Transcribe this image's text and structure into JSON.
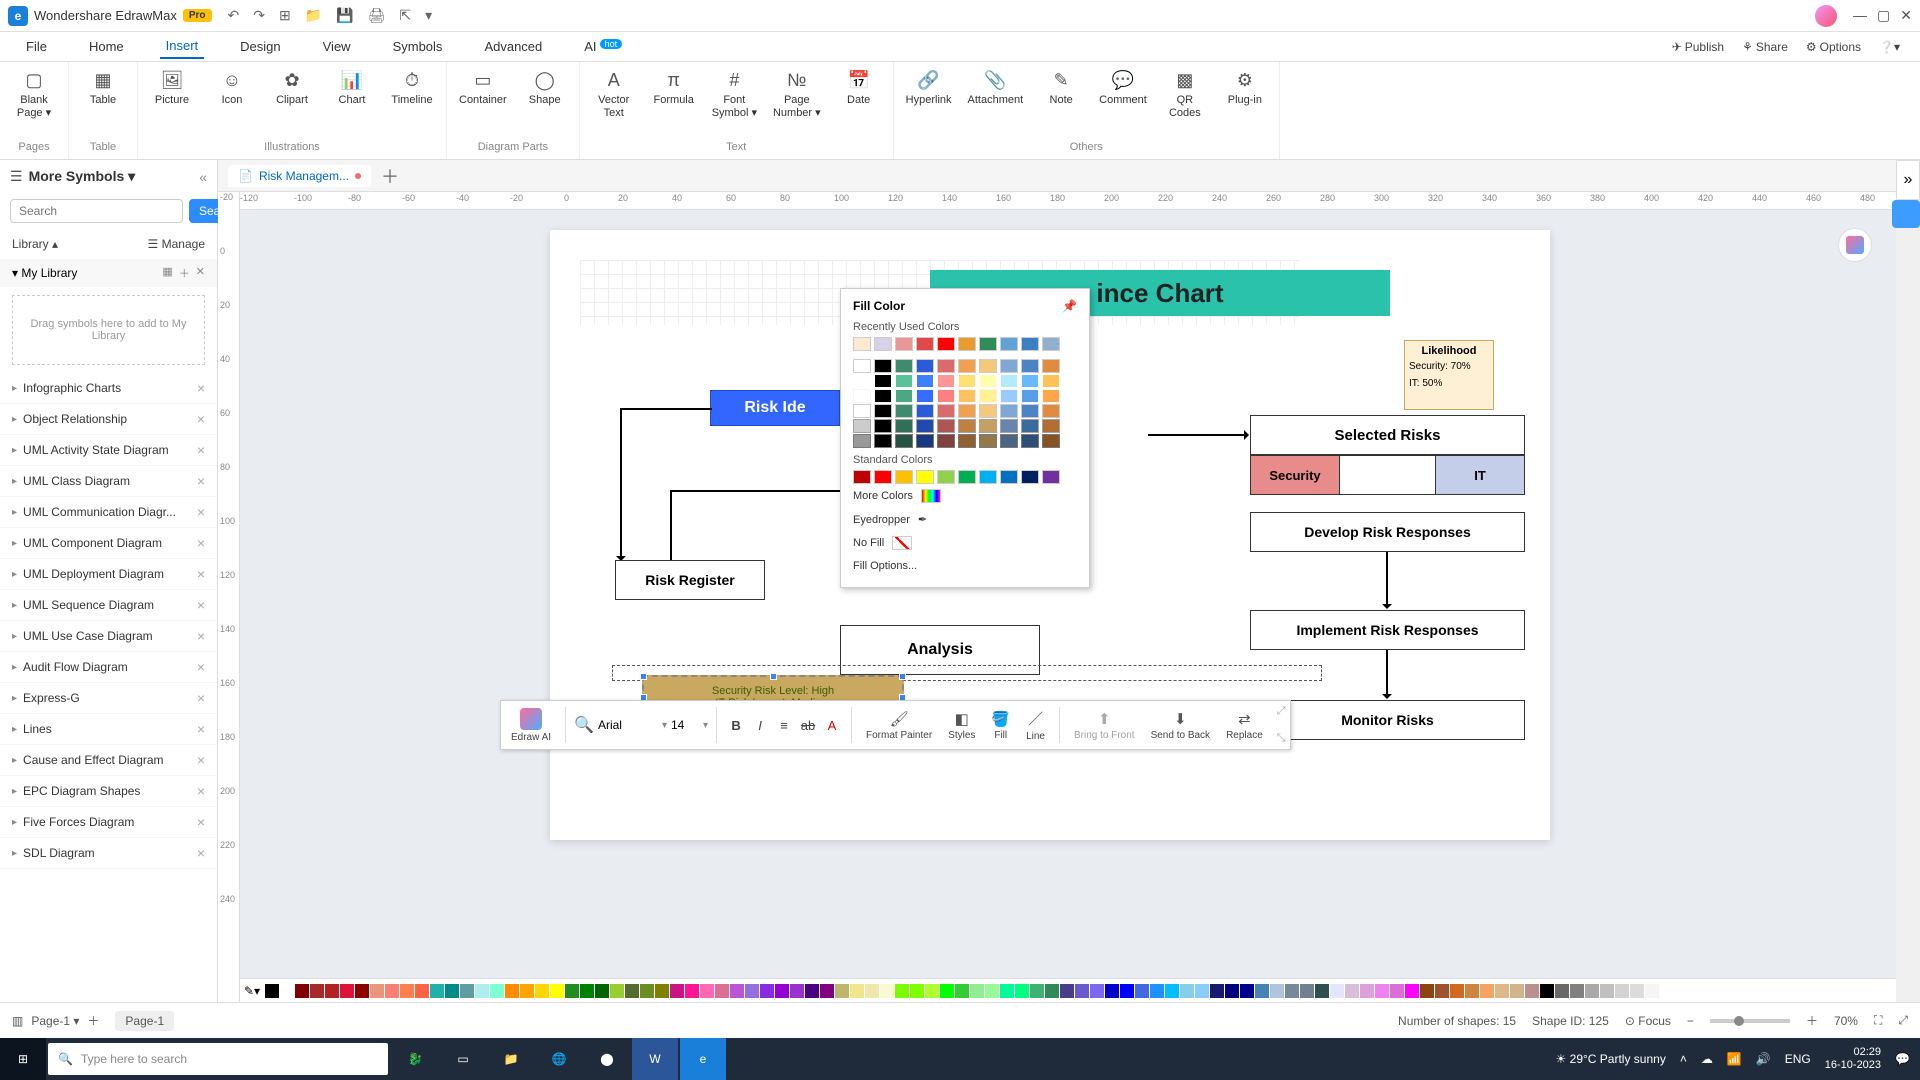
{
  "app": {
    "name": "Wondershare EdrawMax",
    "badge": "Pro"
  },
  "menubar": {
    "items": [
      "File",
      "Home",
      "Insert",
      "Design",
      "View",
      "Symbols",
      "Advanced",
      "AI"
    ],
    "active_index": 2,
    "right": {
      "publish": "Publish",
      "share": "Share",
      "options": "Options"
    }
  },
  "ribbon": {
    "groups": [
      {
        "label": "Pages",
        "items": [
          {
            "label": "Blank\nPage ▾"
          }
        ]
      },
      {
        "label": "Table",
        "items": [
          {
            "label": "Table"
          }
        ]
      },
      {
        "label": "Illustrations",
        "items": [
          {
            "label": "Picture"
          },
          {
            "label": "Icon"
          },
          {
            "label": "Clipart"
          },
          {
            "label": "Chart"
          },
          {
            "label": "Timeline"
          }
        ]
      },
      {
        "label": "Diagram Parts",
        "items": [
          {
            "label": "Container"
          },
          {
            "label": "Shape"
          }
        ]
      },
      {
        "label": "Text",
        "items": [
          {
            "label": "Vector\nText"
          },
          {
            "label": "Formula"
          },
          {
            "label": "Font\nSymbol ▾"
          },
          {
            "label": "Page\nNumber ▾"
          },
          {
            "label": "Date"
          }
        ]
      },
      {
        "label": "Others",
        "items": [
          {
            "label": "Hyperlink"
          },
          {
            "label": "Attachment"
          },
          {
            "label": "Note"
          },
          {
            "label": "Comment"
          },
          {
            "label": "QR\nCodes"
          },
          {
            "label": "Plug-in"
          }
        ]
      }
    ]
  },
  "sidebar": {
    "title": "More Symbols",
    "search_placeholder": "Search",
    "search_button": "Search",
    "library": "Library",
    "manage": "Manage",
    "mylib": "My Library",
    "dropzone": "Drag symbols here to add to My Library",
    "categories": [
      "Infographic Charts",
      "Object Relationship",
      "UML Activity State Diagram",
      "UML Class Diagram",
      "UML Communication Diagr...",
      "UML Component Diagram",
      "UML Deployment Diagram",
      "UML Sequence Diagram",
      "UML Use Case Diagram",
      "Audit Flow Diagram",
      "Express-G",
      "Lines",
      "Cause and Effect Diagram",
      "EPC Diagram Shapes",
      "Five Forces Diagram",
      "SDL Diagram"
    ]
  },
  "doc_tab": {
    "name": "Risk Managem...",
    "modified": true
  },
  "ruler_h": [
    "-120",
    "-100",
    "-80",
    "-60",
    "-40",
    "-20",
    "0",
    "20",
    "40",
    "60",
    "80",
    "100",
    "120",
    "140",
    "160",
    "180",
    "200",
    "220",
    "240",
    "260",
    "280",
    "300",
    "320",
    "340",
    "360",
    "380",
    "400",
    "420",
    "440",
    "460",
    "480"
  ],
  "ruler_v": [
    "-20",
    "0",
    "20",
    "40",
    "60",
    "80",
    "100",
    "120",
    "140",
    "160",
    "180",
    "200",
    "220",
    "240"
  ],
  "diagram": {
    "title": "ince Chart",
    "risk_id": "Risk Ide",
    "risk_register": "Risk Register",
    "analysis": "Analysis",
    "sel_note_1": "Security Risk Level: High",
    "sel_note_2": "IT Risk Impact: Medium",
    "likelihood": {
      "title": "Likelihood",
      "security": "Security: 70%",
      "it": "IT: 50%"
    },
    "selected_risks": "Selected Risks",
    "security": "Security",
    "it": "IT",
    "develop": "Develop Risk Responses",
    "implement": "Implement Risk Responses",
    "monitor": "Monitor Risks"
  },
  "color_popup": {
    "title": "Fill Color",
    "recent_label": "Recently Used Colors",
    "recent": [
      "#fde9cf",
      "#d7d2e8",
      "#e99797",
      "#e04a4a",
      "#ff0000",
      "#e89b2f",
      "#2f8b57",
      "#5fa3d6",
      "#3d7fc1",
      "#8fb0cf"
    ],
    "theme_row1": [
      "#ffffff",
      "#000000",
      "#3f8b6f",
      "#2b5bd7",
      "#d96b6b",
      "#f0a050",
      "#f5c97b",
      "#7fa8d9",
      "#4a84c4",
      "#e08b3d"
    ],
    "theme_shades": 5,
    "standard_label": "Standard Colors",
    "standard": [
      "#c00000",
      "#ff0000",
      "#ffc000",
      "#ffff00",
      "#92d050",
      "#00b050",
      "#00b0f0",
      "#0070c0",
      "#002060",
      "#7030a0"
    ],
    "more": "More Colors",
    "eyedropper": "Eyedropper",
    "nofill": "No Fill",
    "fill_options": "Fill Options..."
  },
  "float_toolbar": {
    "ai": "Edraw AI",
    "font": "Arial",
    "size": "14",
    "format_painter": "Format\nPainter",
    "styles": "Styles",
    "fill": "Fill",
    "line": "Line",
    "bring_front": "Bring to\nFront",
    "send_back": "Send to\nBack",
    "replace": "Replace"
  },
  "statusbar": {
    "page": "Page-1",
    "page_tab": "Page-1",
    "shapes": "Number of shapes: 15",
    "shape_id": "Shape ID: 125",
    "focus": "Focus",
    "zoom": "70%"
  },
  "os": {
    "search_placeholder": "Type here to search",
    "weather": "29°C  Partly sunny",
    "lang": "ENG",
    "time": "02:29",
    "date": "16-10-2023"
  },
  "palette_colors": [
    "#000",
    "#fff",
    "#800000",
    "#a52a2a",
    "#b22222",
    "#dc143c",
    "#8b0000",
    "#e9967a",
    "#fa8072",
    "#ff7f50",
    "#ff6347",
    "#20b2aa",
    "#008b8b",
    "#5f9ea0",
    "#afeeee",
    "#7fffd4",
    "#ff8c00",
    "#ffa500",
    "#ffd700",
    "#ffff00",
    "#228b22",
    "#008000",
    "#006400",
    "#9acd32",
    "#556b2f",
    "#6b8e23",
    "#808000",
    "#c71585",
    "#ff1493",
    "#ff69b4",
    "#db7093",
    "#ba55d3",
    "#9370db",
    "#8a2be2",
    "#9400d3",
    "#9932cc",
    "#4b0082",
    "#800080",
    "#bdb76b",
    "#f0e68c",
    "#eee8aa",
    "#fafad2",
    "#7cfc00",
    "#7fff00",
    "#adff2f",
    "#00ff00",
    "#32cd32",
    "#90ee90",
    "#98fb98",
    "#00fa9a",
    "#00ff7f",
    "#3cb371",
    "#2e8b57",
    "#483d8b",
    "#6a5acd",
    "#7b68ee",
    "#0000cd",
    "#0000ff",
    "#4169e1",
    "#1e90ff",
    "#00bfff",
    "#87ceeb",
    "#87cefa",
    "#191970",
    "#000080",
    "#00008b",
    "#4682b4",
    "#b0c4de",
    "#778899",
    "#708090",
    "#2f4f4f",
    "#e6e6fa",
    "#d8bfd8",
    "#dda0dd",
    "#ee82ee",
    "#da70d6",
    "#ff00ff",
    "#8b4513",
    "#a0522d",
    "#d2691e",
    "#cd853f",
    "#f4a460",
    "#deb887",
    "#d2b48c",
    "#bc8f8f",
    "#000000",
    "#696969",
    "#808080",
    "#a9a9a9",
    "#c0c0c0",
    "#d3d3d3",
    "#dcdcdc",
    "#f5f5f5",
    "#ffffff"
  ]
}
